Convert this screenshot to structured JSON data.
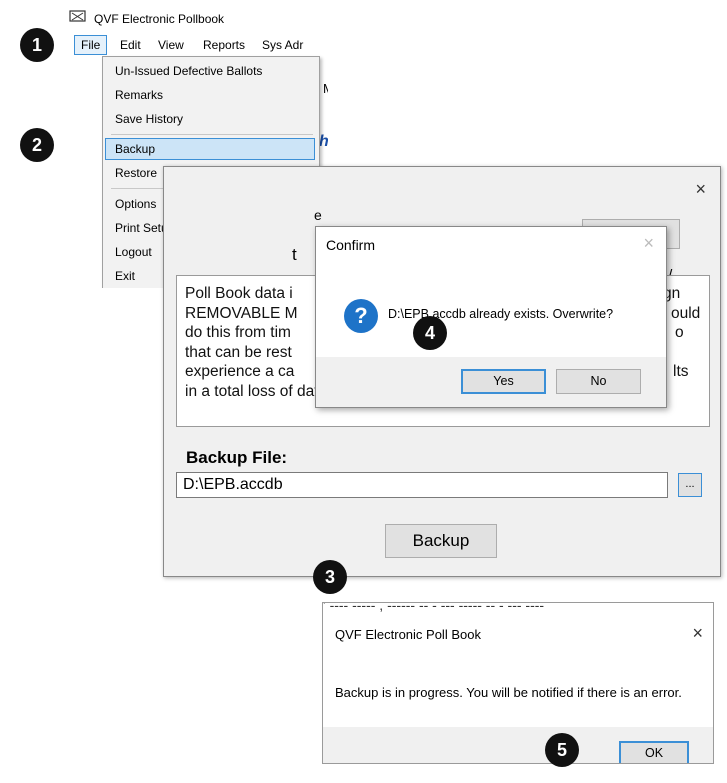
{
  "app": {
    "title": "QVF Electronic Pollbook",
    "menus": [
      "File",
      "Edit",
      "View",
      "Reports",
      "Sys Adr"
    ],
    "file_menu": {
      "items": [
        "Un-Issued Defective Ballots",
        "Remarks",
        "Save History",
        "Backup",
        "Restore",
        "Options",
        "Print Setup",
        "Logout",
        "Exit"
      ],
      "highlighted": "Backup"
    },
    "background_fragment_1": "MI",
    "background_fragment_2": "h"
  },
  "backup_dialog": {
    "close_glyph": "×",
    "fragment_e": "e",
    "fragment_t": "t",
    "right_fragment": "E /",
    "top_button_label": "e",
    "description_lines": [
      "Poll Book data i",
      "REMOVABLE M",
      "do this from tim",
      "that can be rest",
      "experience a ca",
      "in a total loss of data."
    ],
    "description_right_fragments": [
      "gn",
      "ould",
      "o",
      "",
      "lts",
      ""
    ],
    "backup_file_label": "Backup File:",
    "backup_file_value": "D:\\EPB.accdb",
    "browse_label": "...",
    "backup_button": "Backup"
  },
  "confirm_dialog": {
    "title": "Confirm",
    "close_glyph": "×",
    "icon": "question-icon",
    "icon_glyph": "?",
    "message": "D:\\EPB.accdb already exists. Overwrite?",
    "yes_label": "Yes",
    "no_label": "No"
  },
  "progress_dialog": {
    "top_fragment": "' ---- ----- , ------ -- - --- ----- -- - --- ----",
    "title": "QVF Electronic Poll Book",
    "close_glyph": "×",
    "message": "Backup is in progress. You will be notified if there is an error.",
    "ok_label": "OK"
  },
  "step_badges": [
    "1",
    "2",
    "3",
    "4",
    "5"
  ]
}
